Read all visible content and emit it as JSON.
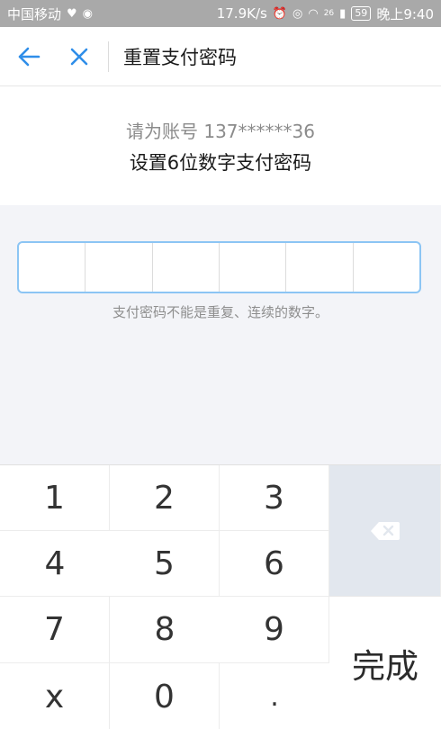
{
  "status_bar": {
    "carrier": "中国移动",
    "speed": "17.9K/s",
    "network": "26",
    "battery": "59",
    "time": "晚上9:40"
  },
  "nav": {
    "title": "重置支付密码"
  },
  "header": {
    "account_line": "请为账号 137******36",
    "instruction": "设置6位数字支付密码"
  },
  "pin": {
    "length": 6,
    "hint": "支付密码不能是重复、连续的数字。"
  },
  "keypad": {
    "keys": [
      "1",
      "2",
      "3",
      "4",
      "5",
      "6",
      "7",
      "8",
      "9",
      "x",
      "0",
      "."
    ],
    "done_label": "完成"
  },
  "colors": {
    "accent": "#2f8ee9",
    "pin_border": "#8cc5f4",
    "delete_bg": "#e2e7ee"
  }
}
